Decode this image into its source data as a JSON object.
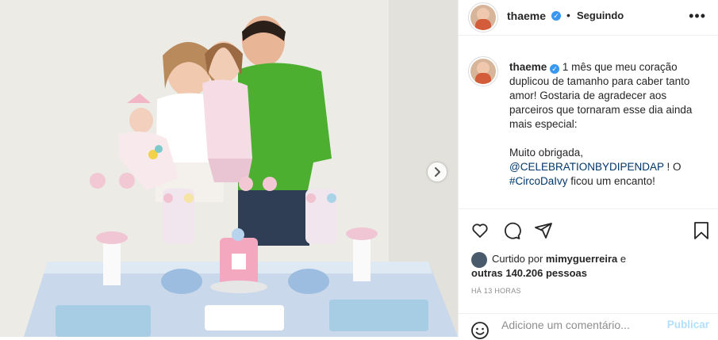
{
  "post": {
    "username": "thaeme",
    "verified": true,
    "separator": "•",
    "follow_status": "Seguindo",
    "more_label": "•••"
  },
  "caption": {
    "username": "thaeme",
    "line1": "1 mês que meu coração duplicou de tamanho para caber tanto amor! Gostaria de agradecer aos parceiros que tornaram esse dia ainda mais especial:",
    "line2": "Muito obrigada,",
    "mention": "@CELEBRATIONBYDIPENDAP",
    "after_mention": " ! O",
    "hashtag": "#CircoDaIvy",
    "after_hashtag": " ficou um encanto!"
  },
  "likes": {
    "prefix": "Curtido por ",
    "liker": "mimyguerreira",
    "middle": " e",
    "others": "outras 140.206 pessoas"
  },
  "time_ago": "HÁ 13 HORAS",
  "comment": {
    "placeholder": "Adicione um comentário...",
    "publish_label": "Publicar"
  },
  "colors": {
    "verified": "#3897f0",
    "link": "#00376b",
    "publish_disabled": "#b2dffc",
    "shirt_green": "#4caf2f"
  },
  "icons": [
    "verified-badge-icon",
    "more-options-icon",
    "heart-icon",
    "comment-icon",
    "share-icon",
    "bookmark-icon",
    "emoji-icon",
    "next-arrow-icon"
  ]
}
